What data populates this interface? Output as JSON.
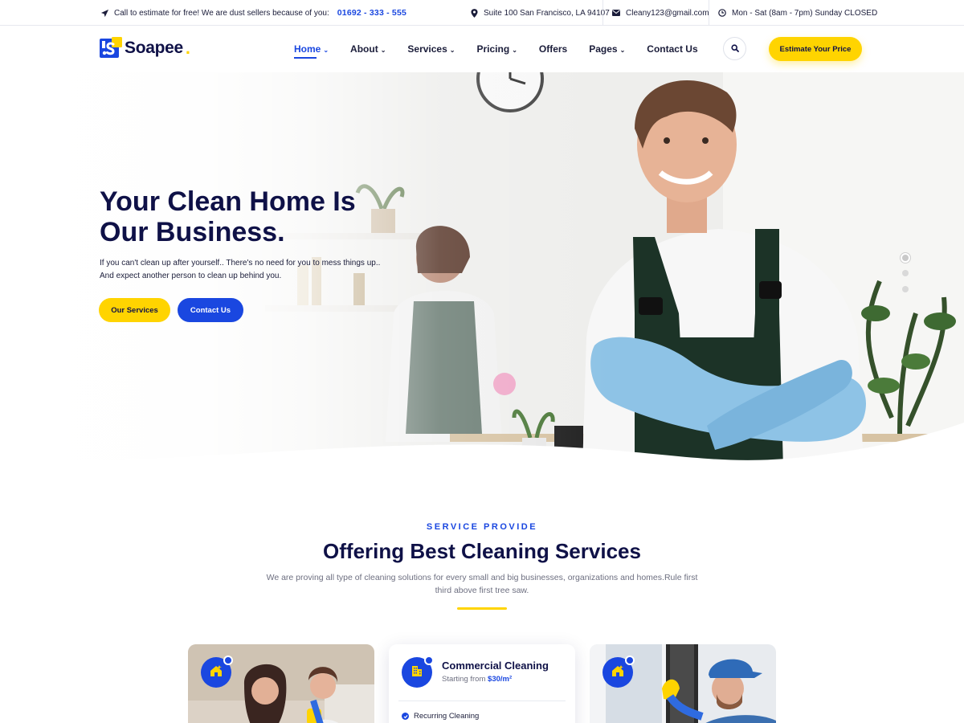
{
  "topbar": {
    "call_text": "Call to estimate for free! We are dust sellers because of you:",
    "phone": "01692 - 333 - 555",
    "address": "Suite 100 San Francisco, LA 94107",
    "email": "Cleany123@gmail.com",
    "hours": "Mon - Sat (8am - 7pm) Sunday CLOSED",
    "icons": [
      "paper-plane-icon",
      "location-pin-icon",
      "envelope-icon",
      "clock-icon"
    ]
  },
  "header": {
    "logo_text": "Soapee",
    "logo_dot": ".",
    "nav": [
      {
        "label": "Home",
        "active": true,
        "dropdown": true
      },
      {
        "label": "About",
        "dropdown": true
      },
      {
        "label": "Services",
        "dropdown": true
      },
      {
        "label": "Pricing",
        "dropdown": true
      },
      {
        "label": "Offers",
        "dropdown": false
      },
      {
        "label": "Pages",
        "dropdown": true
      },
      {
        "label": "Contact Us",
        "dropdown": false
      }
    ],
    "estimate_button": "Estimate Your Price"
  },
  "hero": {
    "title_line1": "Your Clean Home Is",
    "title_line2": "Our Business.",
    "text": "If you can't clean up after yourself.. There's no need for you to mess things up.. And expect another person to clean up behind you.",
    "btn_services": "Our Services",
    "btn_contact": "Contact Us",
    "slides": 3,
    "active_slide": 1
  },
  "services": {
    "eyebrow": "SERVICE PROVIDE",
    "title": "Offering Best Cleaning Services",
    "description": "We are proving all type of cleaning solutions for every small and big businesses, organizations and homes.Rule first third above first tree saw.",
    "cards": [
      {
        "type": "image",
        "icon": "home-cleaning-icon"
      },
      {
        "type": "info",
        "icon": "building-icon",
        "title": "Commercial Cleaning",
        "price_prefix": "Starting from",
        "price": "$30/m²",
        "item": "Recurring Cleaning"
      },
      {
        "type": "image",
        "icon": "home-cleaning-icon"
      }
    ]
  },
  "colors": {
    "primary": "#1a47e0",
    "accent": "#ffd400",
    "heading": "#0f1147",
    "text": "#6d6f80"
  }
}
